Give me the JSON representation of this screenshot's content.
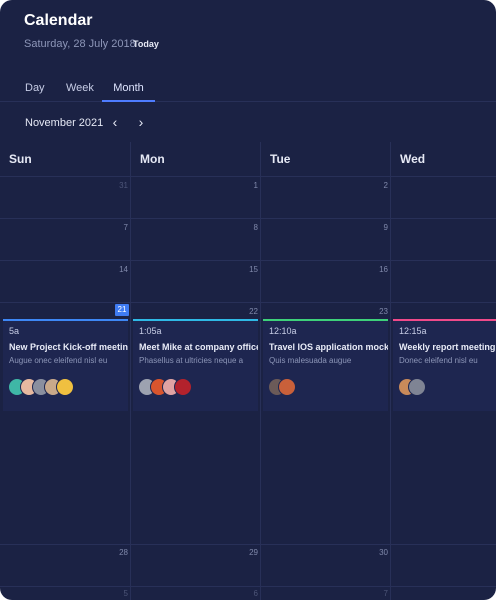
{
  "header": {
    "title": "Calendar",
    "date": "Saturday, 28 July 2018",
    "today_label": "Today"
  },
  "tabs": [
    {
      "label": "Day"
    },
    {
      "label": "Week"
    },
    {
      "label": "Month",
      "active": true
    }
  ],
  "nav": {
    "month_label": "November 2021",
    "prev_icon": "chevron-left-icon",
    "next_icon": "chevron-right-icon"
  },
  "weekdays": [
    "Sun",
    "Mon",
    "Tue",
    "Wed"
  ],
  "days": {
    "row1": [
      "31",
      "1",
      "2"
    ],
    "row2": [
      "7",
      "8",
      "9"
    ],
    "row3": [
      "14",
      "15",
      "16"
    ],
    "row4": [
      "21",
      "22",
      "23"
    ],
    "row5": [
      "28",
      "29",
      "30"
    ],
    "row6": [
      "5",
      "6",
      "7"
    ]
  },
  "events": [
    {
      "time": "5a",
      "title": "New Project Kick-off meeting",
      "desc": "Augue onec eleifend nisl eu",
      "accent": "#3e87f5"
    },
    {
      "time": "1:05a",
      "title": "Meet Mike at company office",
      "desc": "Phasellus at ultricies neque a",
      "accent": "#2fb9e6"
    },
    {
      "time": "12:10a",
      "title": "Travel IOS application mockup",
      "desc": "Quis malesuada augue",
      "accent": "#3ed17a"
    },
    {
      "time": "12:15a",
      "title": "Weekly report meeting",
      "desc": "Donec eleifend nisl eu",
      "accent": "#f04a8a"
    }
  ],
  "colors": {
    "panel_bg": "#1b2244",
    "grid_line": "#283058",
    "accent_blue": "#4e7cff",
    "today_badge": "#3f7bf2"
  }
}
